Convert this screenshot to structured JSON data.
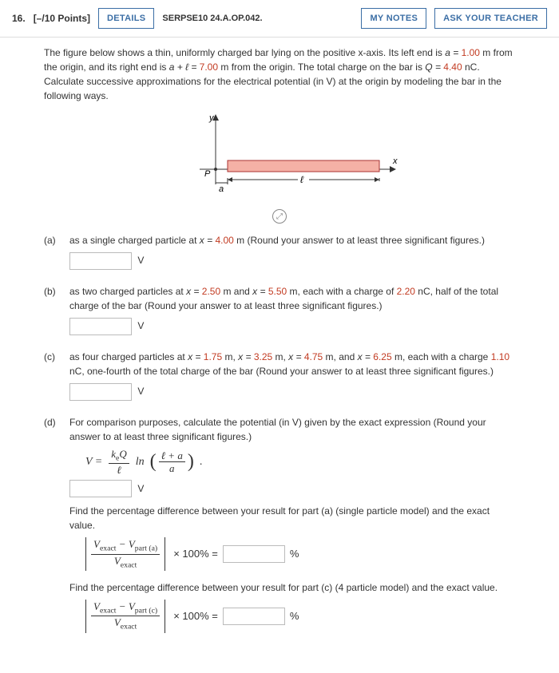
{
  "header": {
    "qnum": "16.",
    "points": "[–/10 Points]",
    "details_btn": "DETAILS",
    "source": "SERPSE10 24.A.OP.042.",
    "mynotes_btn": "MY NOTES",
    "askteacher_btn": "ASK YOUR TEACHER"
  },
  "intro": {
    "t1": "The figure below shows a thin, uniformly charged bar lying on the positive x-axis. Its left end is ",
    "a_eq": "a = ",
    "a_val": "1.00",
    "t2": " m from the origin, and its right end is ",
    "al_eq": "a + ℓ = ",
    "al_val": "7.00",
    "t3": " m from the origin. The total charge on the bar is ",
    "q_eq": "Q = ",
    "q_val": "4.40",
    "t4": " nC. Calculate successive approximations for the electrical potential (in V) at the origin by modeling the bar in the following ways."
  },
  "fig": {
    "y": "y",
    "x": "x",
    "P": "P",
    "a": "a",
    "l": "ℓ"
  },
  "parts": {
    "a": {
      "label": "(a)",
      "t1": "as a single charged particle at ",
      "x_eq": "x = ",
      "x_val": "4.00",
      "t2": " m (Round your answer to at least three significant figures.)",
      "unit": "V"
    },
    "b": {
      "label": "(b)",
      "t1": "as two charged particles at ",
      "x1_eq": "x = ",
      "x1_val": "2.50",
      "t2": " m and ",
      "x2_eq": "x = ",
      "x2_val": "5.50",
      "t3": " m, each with a charge of ",
      "q_val": "2.20",
      "t4": " nC, half of the total charge of the bar (Round your answer to at least three significant figures.)",
      "unit": "V"
    },
    "c": {
      "label": "(c)",
      "t1": "as four charged particles at ",
      "x1_eq": "x = ",
      "x1_val": "1.75",
      "m1": " m, ",
      "x2_eq": "x = ",
      "x2_val": "3.25",
      "m2": " m, ",
      "x3_eq": "x = ",
      "x3_val": "4.75",
      "m3": " m, and ",
      "x4_eq": "x = ",
      "x4_val": "6.25",
      "t2": " m, each with a charge ",
      "q_val": "1.10",
      "t3": " nC, one-fourth of the total charge of the bar (Round your answer to at least three significant figures.)",
      "unit": "V"
    },
    "d": {
      "label": "(d)",
      "t1": "For comparison purposes, calculate the potential (in V) given by the exact expression (Round your answer to at least three significant figures.)",
      "formula": {
        "veq": "V =",
        "num": "k<sub>e</sub>Q",
        "den": "ℓ",
        "ln": "ln",
        "fnum": "ℓ + a",
        "fden": "a",
        "dot": "."
      },
      "unit": "V",
      "diff_a_text": "Find the percentage difference between your result for part (a) (single particle model) and the exact value.",
      "diff_c_text": "Find the percentage difference between your result for part (c) (4 particle model) and the exact value.",
      "diff": {
        "vexact": "V<sub>exact</sub>",
        "minus": " − ",
        "vparta": "V<sub>part (a)</sub>",
        "vpartc": "V<sub>part (c)</sub>",
        "times100": " × 100% = ",
        "pct": "%"
      }
    }
  }
}
